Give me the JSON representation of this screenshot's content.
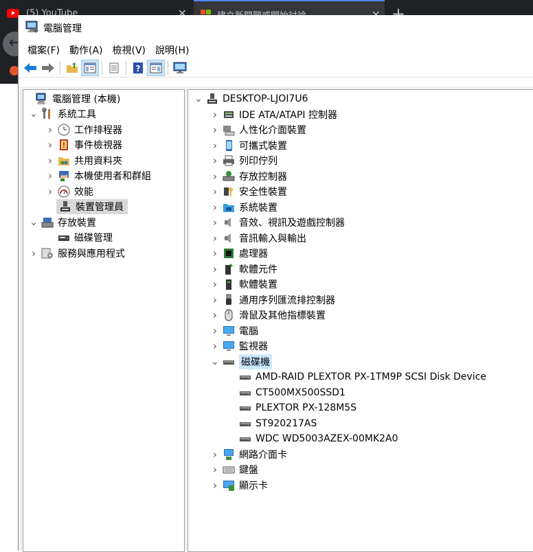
{
  "browser": {
    "tabs": [
      {
        "title": "(5) YouTube"
      },
      {
        "title": "建立新問題或開始討論"
      }
    ],
    "new_tab": "+",
    "back": "←",
    "close": "✕"
  },
  "window": {
    "title": "電腦管理",
    "menu": [
      "檔案(F)",
      "動作(A)",
      "檢視(V)",
      "說明(H)"
    ]
  },
  "toolbar": {
    "buttons": [
      "back-icon",
      "forward-icon",
      "up-folder-icon",
      "show-hide-tree-icon",
      "properties-icon",
      "help-icon",
      "show-action-pane-icon",
      "monitor-icon"
    ]
  },
  "left_tree": {
    "root": "電腦管理 (本機)",
    "system_tools": "系統工具",
    "task_scheduler": "工作排程器",
    "event_viewer": "事件檢視器",
    "shared_folders": "共用資料夾",
    "local_users": "本機使用者和群組",
    "performance": "效能",
    "device_manager": "裝置管理員",
    "storage": "存放裝置",
    "disk_management": "磁碟管理",
    "services_apps": "服務與應用程式"
  },
  "device_tree": {
    "root": "DESKTOP-LJOI7U6",
    "categories": [
      "IDE ATA/ATAPI 控制器",
      "人性化介面裝置",
      "可攜式裝置",
      "列印佇列",
      "存放控制器",
      "安全性裝置",
      "系統裝置",
      "音效、視訊及遊戲控制器",
      "音訊輸入與輸出",
      "處理器",
      "軟體元件",
      "軟體裝置",
      "通用序列匯流排控制器",
      "滑鼠及其他指標裝置",
      "電腦",
      "監視器",
      "磁碟機"
    ],
    "disk_drives": [
      "AMD-RAID PLEXTOR PX-1TM9P SCSI Disk Device",
      "CT500MX500SSD1",
      "PLEXTOR PX-128M5S",
      "ST920217AS",
      "WDC WD5003AZEX-00MK2A0"
    ],
    "after": [
      "網路介面卡",
      "鍵盤",
      "顯示卡"
    ]
  },
  "colors": {
    "selection": "#cce8ff",
    "inactive_selection": "#d9d9d9",
    "accent": "#0078d7"
  }
}
